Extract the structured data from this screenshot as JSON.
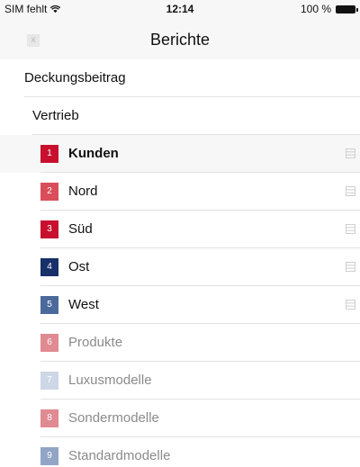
{
  "status_bar": {
    "carrier": "SIM fehlt",
    "wifi_icon": "wifi-icon",
    "time": "12:14",
    "battery_percent": "100 %",
    "battery_icon": "battery-icon"
  },
  "nav": {
    "close_icon": "close-icon",
    "close_glyph": "x",
    "title": "Berichte"
  },
  "sections": [
    {
      "label": "Deckungsbeitrag"
    },
    {
      "label": "Vertrieb"
    }
  ],
  "items": [
    {
      "number": "1",
      "label": "Kunden",
      "color": "#c8102e",
      "active": true,
      "dimmed": false,
      "handle": true
    },
    {
      "number": "2",
      "label": "Nord",
      "color": "#d94e5a",
      "active": false,
      "dimmed": false,
      "handle": true
    },
    {
      "number": "3",
      "label": "Süd",
      "color": "#c8102e",
      "active": false,
      "dimmed": false,
      "handle": true
    },
    {
      "number": "4",
      "label": "Ost",
      "color": "#17306a",
      "active": false,
      "dimmed": false,
      "handle": true
    },
    {
      "number": "5",
      "label": "West",
      "color": "#4b6a9b",
      "active": false,
      "dimmed": false,
      "handle": true
    },
    {
      "number": "6",
      "label": "Produkte",
      "color": "#e08a92",
      "active": false,
      "dimmed": true,
      "handle": false
    },
    {
      "number": "7",
      "label": "Luxusmodelle",
      "color": "#cdd7e6",
      "active": false,
      "dimmed": true,
      "handle": false
    },
    {
      "number": "8",
      "label": "Sondermodelle",
      "color": "#e08a92",
      "active": false,
      "dimmed": true,
      "handle": false
    },
    {
      "number": "9",
      "label": "Standardmodelle",
      "color": "#93a5c6",
      "active": false,
      "dimmed": true,
      "handle": false
    }
  ],
  "drag_handle_icon": "drag-handle-icon"
}
